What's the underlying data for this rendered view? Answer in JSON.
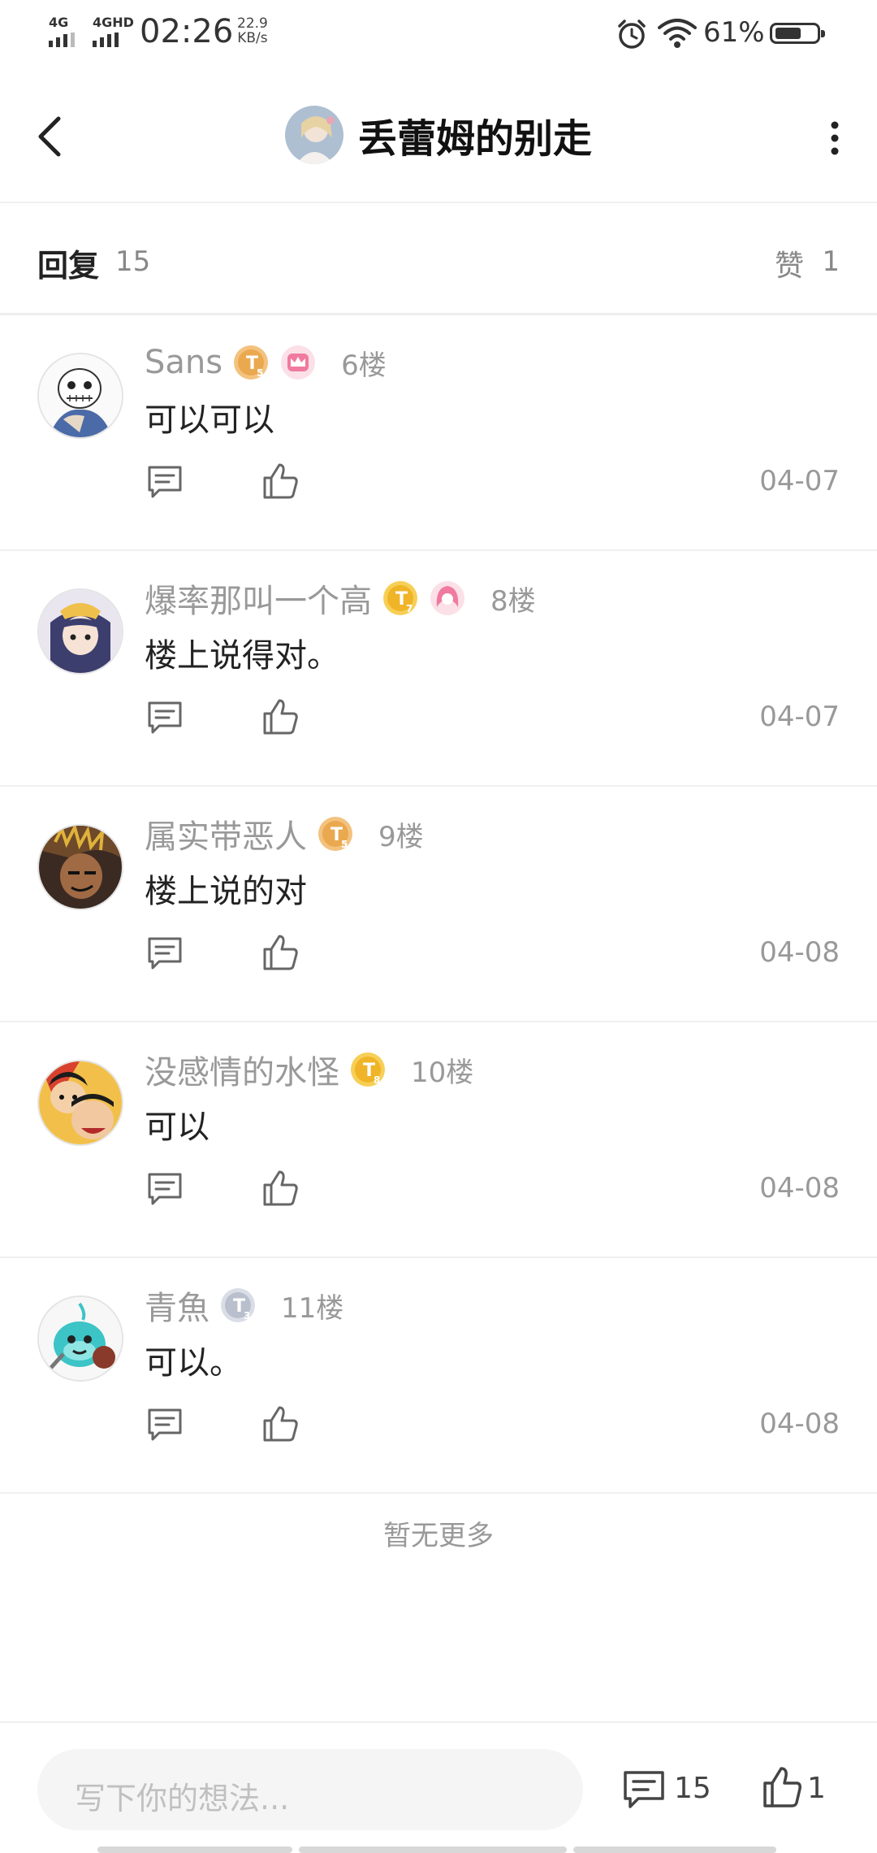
{
  "status": {
    "signal1": "4G",
    "signal2": "4GHD",
    "time": "02:26",
    "speed_value": "22.9",
    "speed_unit": "KB/s",
    "battery_pct_text": "61%",
    "battery_level": 0.61
  },
  "header": {
    "title": "丢蕾姆的别走"
  },
  "reply_bar": {
    "reply_label": "回复",
    "reply_count": "15",
    "like_label": "赞",
    "like_count": "1"
  },
  "comments": [
    {
      "username": "Sans",
      "badge": "T5",
      "floor": "6楼",
      "text": "可以可以",
      "date": "04-07"
    },
    {
      "username": "爆率那叫一个高",
      "badge": "T7",
      "floor": "8楼",
      "text": "楼上说得对。",
      "date": "04-07"
    },
    {
      "username": "属实带恶人",
      "badge": "T5",
      "floor": "9楼",
      "text": "楼上说的对",
      "date": "04-08"
    },
    {
      "username": "没感情的水怪",
      "badge": "T8",
      "floor": "10楼",
      "text": "可以",
      "date": "04-08"
    },
    {
      "username": "青魚",
      "badge": "T3",
      "floor": "11楼",
      "text": "可以。",
      "date": "04-08"
    }
  ],
  "no_more": "暂无更多",
  "bottom": {
    "input_placeholder": "写下你的想法...",
    "reply_count": "15",
    "like_count": "1"
  },
  "colors": {
    "badge_gold": "#f5b93a",
    "badge_silver": "#b9bfcc",
    "crown_pink": "#f07aa0",
    "text_muted": "#999999"
  }
}
